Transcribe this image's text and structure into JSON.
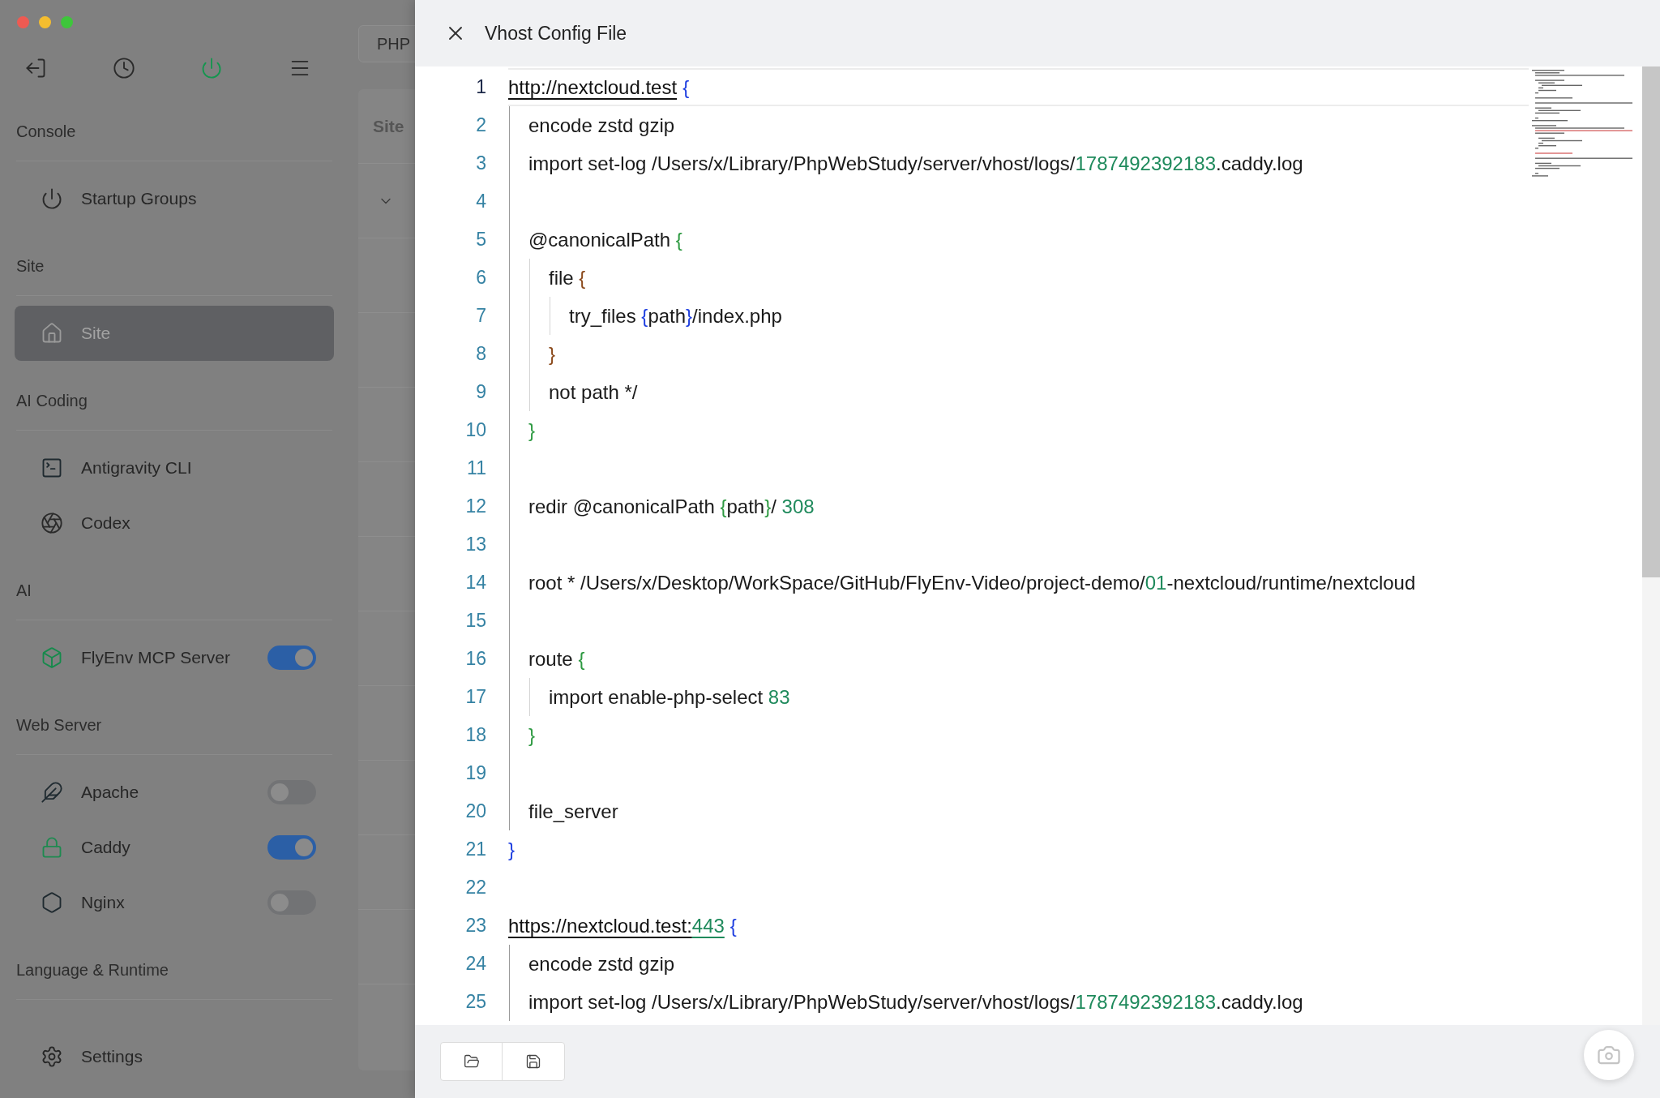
{
  "sidebar": {
    "toolbar": [
      {
        "selected": false
      },
      {
        "selected": false
      },
      {
        "selected": true
      },
      {
        "selected": false
      }
    ],
    "sections": [
      {
        "title": "Console",
        "items": [
          {
            "label": "Startup Groups",
            "kind": "link",
            "selected": false
          }
        ]
      },
      {
        "title": "Site",
        "items": [
          {
            "label": "Site",
            "kind": "link",
            "selected": true
          }
        ]
      },
      {
        "title": "AI Coding",
        "items": [
          {
            "label": "Antigravity CLI",
            "kind": "link",
            "selected": false
          },
          {
            "label": "Codex",
            "kind": "link",
            "selected": false
          }
        ]
      },
      {
        "title": "AI",
        "items": [
          {
            "label": "FlyEnv MCP Server",
            "kind": "toggle",
            "selected": false,
            "on": true
          }
        ]
      },
      {
        "title": "Web Server",
        "items": [
          {
            "label": "Apache",
            "kind": "toggle",
            "selected": false,
            "on": false
          },
          {
            "label": "Caddy",
            "kind": "toggle",
            "selected": false,
            "on": true
          },
          {
            "label": "Nginx",
            "kind": "toggle",
            "selected": false,
            "on": false
          }
        ]
      },
      {
        "title": "Language & Runtime"
      }
    ],
    "settings": "Settings"
  },
  "background_page": {
    "tab": "PHP",
    "card_title": "Site"
  },
  "drawer": {
    "title": "Vhost Config File",
    "lines": [
      {
        "number": "1",
        "active": true,
        "tokens": [
          {
            "kind": "link",
            "text": "http://nextcloud.test"
          },
          {
            "kind": "open",
            "text": "{"
          }
        ]
      },
      {
        "number": "2",
        "active": false,
        "tokens": [
          {
            "kind": "text",
            "text": "encode zstd gzip"
          }
        ]
      },
      {
        "number": "3",
        "active": false,
        "tokens": [
          {
            "kind": "text",
            "text": "import set-log /Users/x/Library/PhpWebStudy/server/vhost/logs/"
          },
          {
            "kind": "number",
            "text": "1787492392183"
          },
          {
            "kind": "text",
            "text": ".caddy.log"
          }
        ]
      },
      {
        "number": "4",
        "active": false
      },
      {
        "number": "5",
        "active": false,
        "tokens": [
          {
            "kind": "text",
            "text": "@canonicalPath "
          },
          {
            "kind": "open",
            "text": "{"
          }
        ]
      },
      {
        "number": "6",
        "active": false,
        "tokens": [
          {
            "kind": "text",
            "text": "file "
          },
          {
            "kind": "open",
            "text": "{"
          }
        ]
      },
      {
        "number": "7",
        "active": false,
        "tokens": [
          {
            "kind": "text",
            "text": "try_files "
          },
          {
            "kind": "open",
            "text": "{"
          },
          {
            "kind": "text",
            "text": "path"
          },
          {
            "kind": "close",
            "text": "}"
          },
          {
            "kind": "text",
            "text": "/index.php"
          }
        ]
      },
      {
        "number": "8",
        "active": false,
        "tokens": [
          {
            "kind": "close",
            "text": "}"
          }
        ]
      },
      {
        "number": "9",
        "active": false,
        "tokens": [
          {
            "kind": "text",
            "text": "not path */"
          }
        ]
      },
      {
        "number": "10",
        "active": false,
        "tokens": [
          {
            "kind": "close",
            "text": "}"
          }
        ]
      },
      {
        "number": "11",
        "active": false
      },
      {
        "number": "12",
        "active": false,
        "tokens": [
          {
            "kind": "text",
            "text": "redir @canonicalPath "
          },
          {
            "kind": "open",
            "text": "{"
          },
          {
            "kind": "text",
            "text": "path"
          },
          {
            "kind": "close",
            "text": "}"
          },
          {
            "kind": "text",
            "text": "/ "
          },
          {
            "kind": "number",
            "text": "308"
          }
        ]
      },
      {
        "number": "13",
        "active": false
      },
      {
        "number": "14",
        "active": false,
        "tokens": [
          {
            "kind": "text",
            "text": "root * /Users/x/Desktop/WorkSpace/GitHub/FlyEnv-Video/project-demo/"
          },
          {
            "kind": "number",
            "text": "01"
          },
          {
            "kind": "text",
            "text": "-nextcloud/runtime/nextcloud"
          }
        ]
      },
      {
        "number": "15",
        "active": false
      },
      {
        "number": "16",
        "active": false,
        "tokens": [
          {
            "kind": "text",
            "text": "route "
          },
          {
            "kind": "open",
            "text": "{"
          }
        ]
      },
      {
        "number": "17",
        "active": false,
        "tokens": [
          {
            "kind": "text",
            "text": "import enable-php-select "
          },
          {
            "kind": "number",
            "text": "83"
          }
        ]
      },
      {
        "number": "18",
        "active": false,
        "tokens": [
          {
            "kind": "close",
            "text": "}"
          }
        ]
      },
      {
        "number": "19",
        "active": false
      },
      {
        "number": "20",
        "active": false,
        "tokens": [
          {
            "kind": "text",
            "text": "file_server"
          }
        ]
      },
      {
        "number": "21",
        "active": false,
        "tokens": [
          {
            "kind": "close",
            "text": "}"
          }
        ]
      },
      {
        "number": "22",
        "active": false
      },
      {
        "number": "23",
        "active": false,
        "tokens": [
          {
            "kind": "link",
            "text": "https://nextcloud.test:"
          },
          {
            "kind": "link-number",
            "text": "443"
          },
          {
            "kind": "open",
            "text": "{"
          }
        ]
      },
      {
        "number": "24",
        "active": false,
        "tokens": [
          {
            "kind": "text",
            "text": "encode zstd gzip"
          }
        ]
      },
      {
        "number": "25",
        "active": false,
        "tokens": [
          {
            "kind": "text",
            "text": "import set-log /Users/x/Library/PhpWebStudy/server/vhost/logs/"
          },
          {
            "kind": "number",
            "text": "1787492392183"
          },
          {
            "kind": "text",
            "text": ".caddy.log"
          }
        ]
      }
    ]
  }
}
